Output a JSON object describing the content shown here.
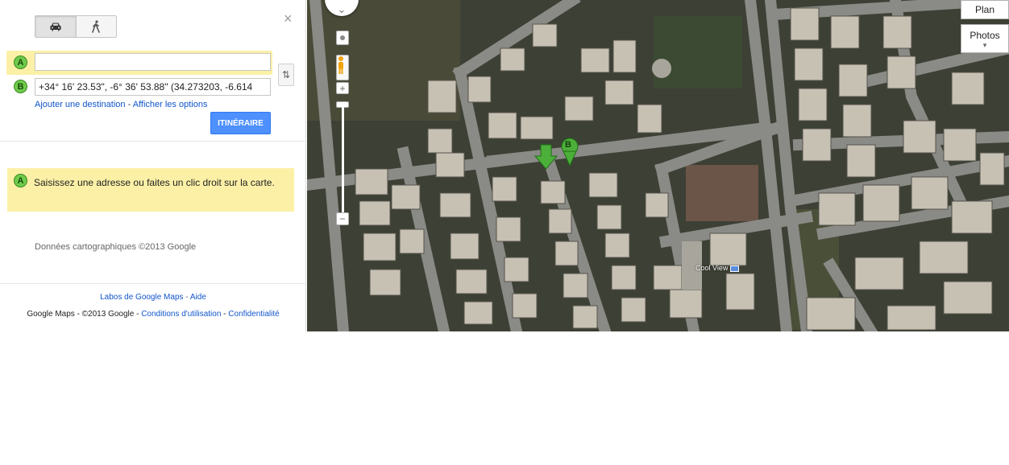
{
  "directions": {
    "modes": [
      {
        "name": "car",
        "icon": "car-icon"
      },
      {
        "name": "walk",
        "icon": "walking-icon"
      }
    ],
    "close_icon": "×",
    "from_marker": "A",
    "to_marker": "B",
    "from_value": "",
    "to_value": "+34° 16' 23.53\", -6° 36' 53.88\" (34.273203, -6.614",
    "swap_icon": "⇅",
    "add_destination": "Ajouter une destination",
    "separator": " - ",
    "show_options": "Afficher les options",
    "submit": "ITINÉRAIRE"
  },
  "hint": {
    "marker": "A",
    "text": "Saisissez une adresse ou faites un clic droit sur la carte."
  },
  "copyright": "Données cartographiques ©2013 Google",
  "footer": {
    "labs": "Labos de Google Maps",
    "dash": " - ",
    "help": "Aide",
    "product": "Google Maps - ©2013 Google - ",
    "terms": "Conditions d'utilisation",
    "privacy": "Confidentialité"
  },
  "map": {
    "zoom_in": "+",
    "zoom_out": "−",
    "type_plan": "Plan",
    "type_photos": "Photos",
    "type_arrow": "▾",
    "pan_icon": "⌄",
    "poi": "Cool View",
    "pin_b": "B",
    "colors": {
      "marker_green": "#6ecb4a",
      "button_blue": "#4d90fe",
      "highlight": "#fbf0a6"
    }
  }
}
